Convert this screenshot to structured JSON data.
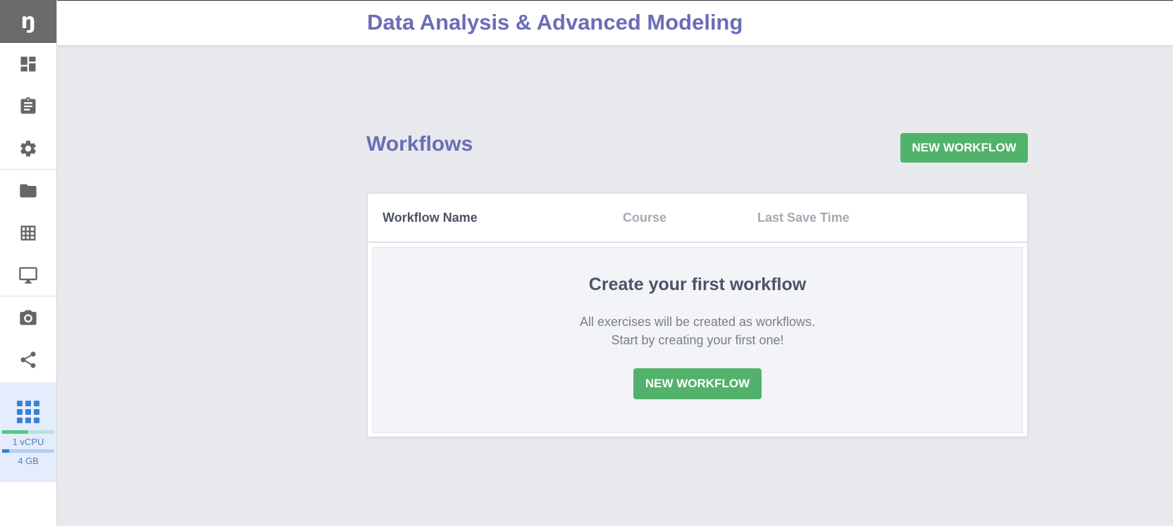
{
  "app": {
    "logo_text": "ŋ",
    "title": "Data Analysis & Advanced Modeling"
  },
  "sidebar": {
    "items": [
      {
        "icon": "dashboard-icon"
      },
      {
        "icon": "clipboard-icon"
      },
      {
        "icon": "gear-icon"
      },
      {
        "icon": "folder-icon"
      },
      {
        "icon": "table-icon"
      },
      {
        "icon": "monitor-icon"
      },
      {
        "icon": "camera-icon"
      },
      {
        "icon": "share-icon"
      }
    ],
    "resources": {
      "icon": "apps-grid-icon",
      "cpu_label": "1 vCPU",
      "cpu_usage_fraction": 0.5,
      "memory_label": "4 GB",
      "memory_usage_fraction": 0.14,
      "cpu_color": "#4ecb83",
      "memory_color": "#3b7fd6"
    }
  },
  "main": {
    "title": "Workflows",
    "new_button_label": "NEW WORKFLOW",
    "table": {
      "columns": [
        "Workflow Name",
        "Course",
        "Last Save Time"
      ]
    },
    "empty_state": {
      "title": "Create your first workflow",
      "line1": "All exercises will be created as workflows.",
      "line2": "Start by creating your first one!",
      "button_label": "NEW WORKFLOW"
    }
  },
  "colors": {
    "accent": "#6a6db7",
    "button": "#52b26b",
    "background": "#e8e9ed"
  }
}
